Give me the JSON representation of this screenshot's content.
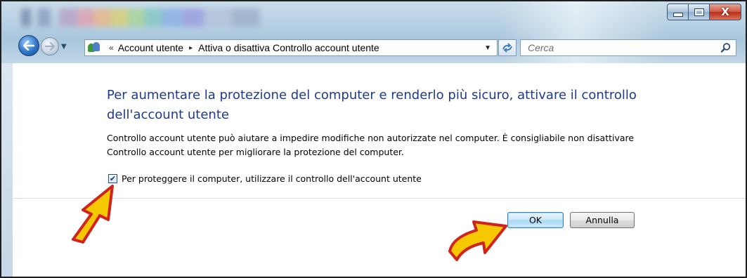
{
  "address_bar": {
    "breadcrumb_prefix": "«",
    "segments": [
      "Account utente",
      "Attiva o disattiva Controllo account utente"
    ],
    "separator": "▸"
  },
  "search": {
    "placeholder": "Cerca"
  },
  "window_controls": {
    "close_label": "X"
  },
  "main": {
    "headline": "Per aumentare la protezione del computer e renderlo più sicuro, attivare il controllo dell'account utente",
    "description": "Controllo account utente può aiutare a impedire modifiche non autorizzate nel computer. È consigliabile non disattivare Controllo account utente per migliorare la protezione del computer.",
    "checkbox": {
      "label": "Per proteggere il computer, utilizzare il controllo dell'account utente",
      "checked": true
    }
  },
  "buttons": {
    "ok_label": "OK",
    "cancel_label": "Annulla"
  },
  "annotations": {
    "arrow_color": "#f5c800",
    "arrow_outline": "#d0231e"
  },
  "icons": [
    "back-arrow-icon",
    "forward-arrow-icon",
    "user-accounts-icon",
    "refresh-icon",
    "search-icon",
    "minimize-icon",
    "maximize-icon",
    "close-icon"
  ]
}
